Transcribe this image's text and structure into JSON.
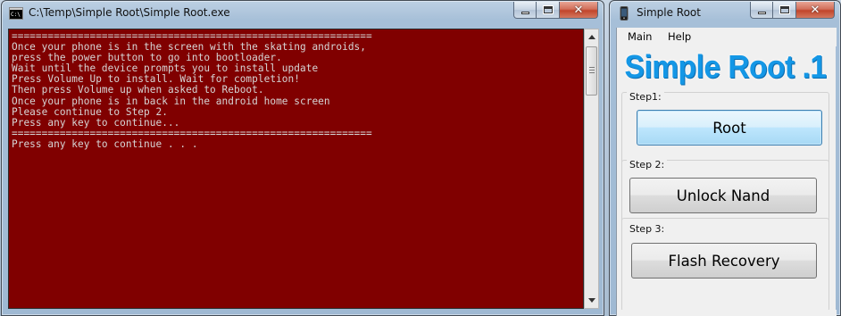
{
  "console_window": {
    "title": "C:\\Temp\\Simple Root\\Simple Root.exe",
    "icon": "cmd-icon",
    "background_color": "#800000",
    "text_color": "#d6d6d6",
    "lines": [
      "============================================================",
      "Once your phone is in the screen with the skating androids,",
      "press the power button to go into bootloader.",
      "Wait until the device prompts you to install update",
      "Press Volume Up to install. Wait for completion!",
      "Then press Volume up when asked to Reboot.",
      "Once your phone is in back in the android home screen",
      "Please continue to Step 2.",
      "Press any key to continue...",
      "============================================================",
      "Press any key to continue . . ."
    ]
  },
  "app_window": {
    "title": "Simple Root",
    "icon": "phone-icon",
    "menu": [
      "Main",
      "Help"
    ],
    "logo_text": "Simple Root .1",
    "logo_color": "#1497e6",
    "steps": [
      {
        "label": "Step1:",
        "button": "Root"
      },
      {
        "label": "Step 2:",
        "button": "Unlock Nand"
      },
      {
        "label": "Step 3:",
        "button": "Flash Recovery"
      }
    ]
  }
}
